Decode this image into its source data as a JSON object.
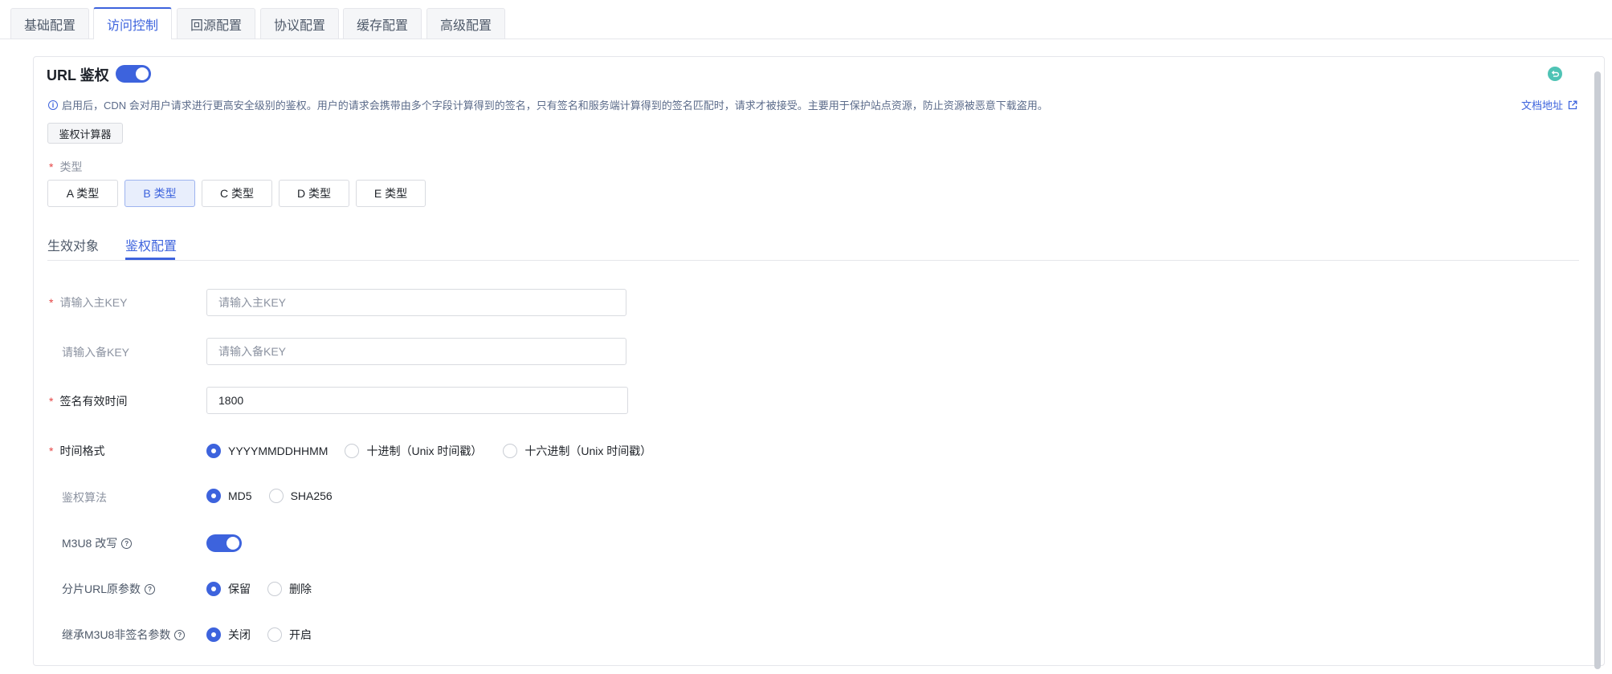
{
  "tabs": [
    {
      "label": "基础配置",
      "active": false
    },
    {
      "label": "访问控制",
      "active": true
    },
    {
      "label": "回源配置",
      "active": false
    },
    {
      "label": "协议配置",
      "active": false
    },
    {
      "label": "缓存配置",
      "active": false
    },
    {
      "label": "高级配置",
      "active": false
    }
  ],
  "section": {
    "title": "URL 鉴权",
    "enabled": true,
    "info_text": "启用后，CDN 会对用户请求进行更高安全级别的鉴权。用户的请求会携带由多个字段计算得到的签名，只有签名和服务端计算得到的签名匹配时，请求才被接受。主要用于保护站点资源，防止资源被恶意下载盗用。",
    "doc_link": "文档地址",
    "calc_button": "鉴权计算器"
  },
  "type_field": {
    "label": "类型",
    "options": [
      "A 类型",
      "B 类型",
      "C 类型",
      "D 类型",
      "E 类型"
    ],
    "selected": "B 类型"
  },
  "sub_tabs": {
    "items": [
      "生效对象",
      "鉴权配置"
    ],
    "active": "鉴权配置"
  },
  "form": {
    "primary_key": {
      "label": "请输入主KEY",
      "placeholder": "请输入主KEY",
      "value": ""
    },
    "backup_key": {
      "label": "请输入备KEY",
      "placeholder": "请输入备KEY",
      "value": ""
    },
    "expire": {
      "label": "签名有效时间",
      "value": "1800"
    },
    "time_format": {
      "label": "时间格式",
      "options": [
        "YYYYMMDDHHMM",
        "十进制（Unix 时间戳）",
        "十六进制（Unix 时间戳）"
      ],
      "selected": "YYYYMMDDHHMM"
    },
    "algorithm": {
      "label": "鉴权算法",
      "options": [
        "MD5",
        "SHA256"
      ],
      "selected": "MD5"
    },
    "m3u8_rewrite": {
      "label": "M3U8 改写",
      "enabled": true
    },
    "slice_params": {
      "label": "分片URL原参数",
      "options": [
        "保留",
        "删除"
      ],
      "selected": "保留"
    },
    "inherit_params": {
      "label": "继承M3U8非签名参数",
      "options": [
        "关闭",
        "开启"
      ],
      "selected": "关闭"
    }
  },
  "colors": {
    "accent": "#3d63dd",
    "required": "#e54545",
    "refresh": "#4fc3b5"
  },
  "icons": [
    "info-icon",
    "external-link-icon",
    "refresh-icon",
    "help-icon"
  ]
}
